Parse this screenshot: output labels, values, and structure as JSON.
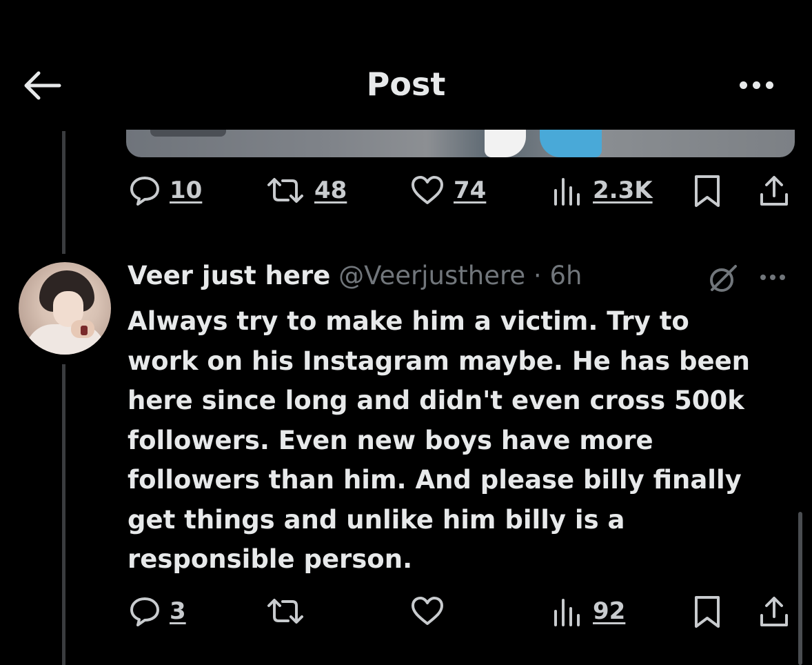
{
  "header": {
    "title": "Post",
    "back_icon": "arrow-left-icon",
    "more_icon": "more-horizontal-icon"
  },
  "parent_post": {
    "actions": {
      "replies": "10",
      "reposts": "48",
      "likes": "74",
      "views": "2.3K"
    }
  },
  "reply": {
    "display_name": "Veer just here",
    "handle_time": "@Veerjusthere · 6h",
    "body_lines": [
      "Always try to make him a victim. Try to",
      "work on his Instagram maybe. He has been",
      "here since long and didn't even cross 500k",
      "followers. Even new boys have more",
      "followers than him. And please billy finally",
      "get things and unlike him billy is a",
      "responsible person."
    ],
    "actions": {
      "replies": "3",
      "views": "92"
    }
  },
  "colors": {
    "background": "#000000",
    "text": "#e7e9ea",
    "secondary": "#71767b",
    "thread_line": "#3a3c3f"
  }
}
